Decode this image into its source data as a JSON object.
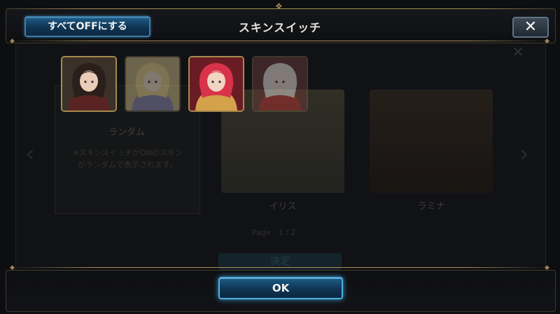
{
  "dialog": {
    "title": "スキンスイッチ",
    "all_off_button": "すべてOFFにする",
    "close_icon": "close-icon",
    "ok_button": "OK"
  },
  "skins": [
    {
      "name": "character-portrait-dark-hair",
      "state": "on",
      "colors": {
        "bg": "#3a3128",
        "hair": "#2a1f1a",
        "skin": "#e9cdb8",
        "cloth": "#5a2424"
      }
    },
    {
      "name": "character-portrait-blonde",
      "state": "off",
      "colors": {
        "bg": "#c9b585",
        "hair": "#e9d48f",
        "skin": "#f0dfca",
        "cloth": "#8e88b0"
      }
    },
    {
      "name": "character-portrait-red-hair",
      "state": "on",
      "colors": {
        "bg": "#6a1c24",
        "hair": "#d8334a",
        "skin": "#f1d4c2",
        "cloth": "#d4a24a"
      }
    },
    {
      "name": "character-portrait-white-hair",
      "state": "off",
      "colors": {
        "bg": "#6a3a3a",
        "hair": "#e8e2dc",
        "skin": "#f3e0d2",
        "cloth": "#b23030"
      }
    }
  ],
  "background": {
    "random_label": "ランダム",
    "random_desc_line1": "※スキンスイッチがONのスキン",
    "random_desc_line2": "がランダムで表示されます。",
    "skin1_label": "イリス",
    "skin2_label": "ラミナ",
    "page": "Page　1 / 2",
    "confirm_button": "決定"
  },
  "colors": {
    "accent": "#1d5b86",
    "gold": "#a68a4e"
  }
}
